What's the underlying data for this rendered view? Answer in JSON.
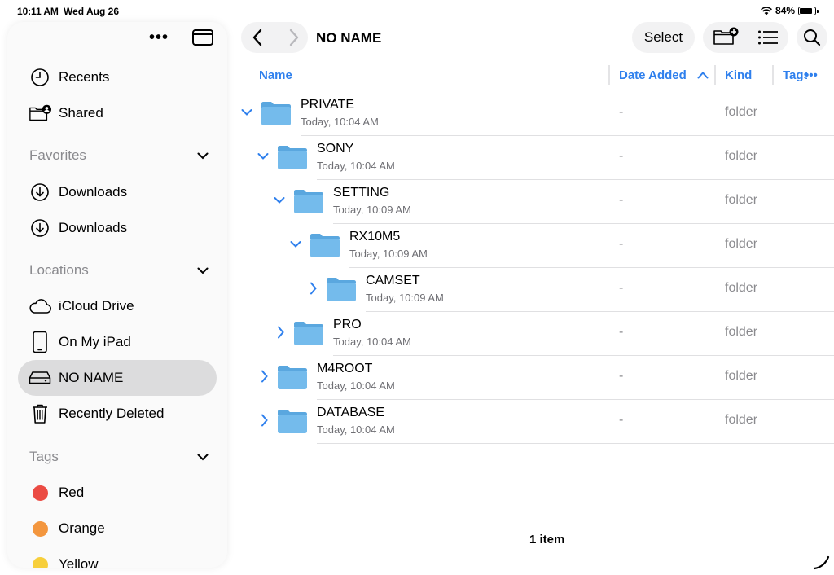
{
  "status": {
    "time": "10:11 AM",
    "date": "Wed Aug 26",
    "battery": "84%",
    "battery_level": 0.84
  },
  "sidebar": {
    "more_label": "•••",
    "recents": "Recents",
    "shared": "Shared",
    "favorites_header": "Favorites",
    "favorites": [
      {
        "label": "Downloads",
        "icon": "download-icon"
      },
      {
        "label": "Downloads",
        "icon": "download-icon"
      }
    ],
    "locations_header": "Locations",
    "locations": [
      {
        "label": "iCloud Drive",
        "icon": "cloud-icon"
      },
      {
        "label": "On My iPad",
        "icon": "ipad-icon"
      },
      {
        "label": "NO NAME",
        "icon": "drive-icon",
        "active": true
      },
      {
        "label": "Recently Deleted",
        "icon": "trash-icon"
      }
    ],
    "tags_header": "Tags",
    "tags": [
      {
        "label": "Red",
        "color": "#eb4b43"
      },
      {
        "label": "Orange",
        "color": "#f3963e"
      },
      {
        "label": "Yellow",
        "color": "#f7cf3b"
      }
    ]
  },
  "header": {
    "title": "NO NAME",
    "select_label": "Select"
  },
  "columns": {
    "name": "Name",
    "date_added": "Date Added",
    "kind": "Kind",
    "tags": "Tags",
    "tags_more": "•••"
  },
  "rows": [
    {
      "name": "PRIVATE",
      "date": "Today, 10:04 AM",
      "added": "-",
      "kind": "folder",
      "expanded": true
    },
    {
      "name": "SONY",
      "date": "Today, 10:04 AM",
      "added": "-",
      "kind": "folder",
      "expanded": true
    },
    {
      "name": "SETTING",
      "date": "Today, 10:09 AM",
      "added": "-",
      "kind": "folder",
      "expanded": true
    },
    {
      "name": "RX10M5",
      "date": "Today, 10:09 AM",
      "added": "-",
      "kind": "folder",
      "expanded": true
    },
    {
      "name": "CAMSET",
      "date": "Today, 10:09 AM",
      "added": "-",
      "kind": "folder",
      "expanded": false
    },
    {
      "name": "PRO",
      "date": "Today, 10:04 AM",
      "added": "-",
      "kind": "folder",
      "expanded": false
    },
    {
      "name": "M4ROOT",
      "date": "Today, 10:04 AM",
      "added": "-",
      "kind": "folder",
      "expanded": false
    },
    {
      "name": "DATABASE",
      "date": "Today, 10:04 AM",
      "added": "-",
      "kind": "folder",
      "expanded": false
    }
  ],
  "footer": {
    "count": "1 item"
  },
  "colors": {
    "accent": "#2f80ed",
    "folder": "#6cb4e8",
    "active_bg": "#dcdcdd"
  }
}
